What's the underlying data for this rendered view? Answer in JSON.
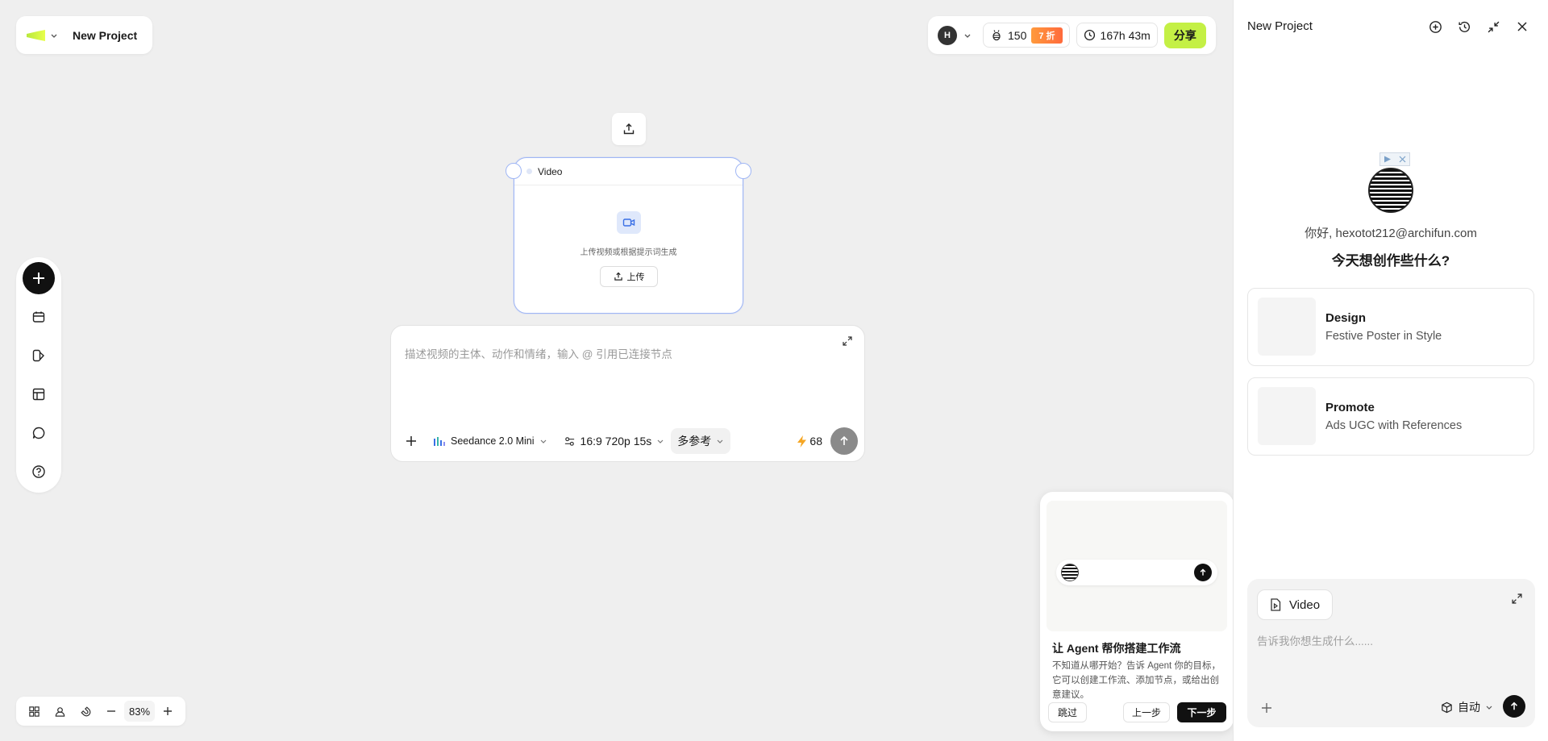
{
  "project": {
    "title": "New Project"
  },
  "status": {
    "avatar_letter": "H",
    "credits": "150",
    "discount": "7 折",
    "time_left": "167h 43m",
    "share_label": "分享"
  },
  "node": {
    "title": "Video",
    "hint": "上传视频或根据提示词生成",
    "upload_label": "上传"
  },
  "prompt": {
    "placeholder": "描述视频的主体、动作和情绪，输入 @ 引用已连接节点",
    "model": "Seedance 2.0 Mini",
    "settings": "16:9 720p 15s",
    "reference": "多参考",
    "cost": "68"
  },
  "zoom": {
    "level": "83%"
  },
  "tour": {
    "title": "让 Agent 帮你搭建工作流",
    "body": "不知道从哪开始？告诉 Agent 你的目标，它可以创建工作流、添加节点，或给出创意建议。",
    "skip": "跳过",
    "prev": "上一步",
    "next": "下一步"
  },
  "panel": {
    "title": "New Project",
    "greeting": "你好, hexotot212@archifun.com",
    "question": "今天想创作些什么?",
    "suggestions": [
      {
        "title": "Design",
        "subtitle": "Festive Poster in Style"
      },
      {
        "title": "Promote",
        "subtitle": "Ads UGC with References"
      }
    ],
    "composer": {
      "chip": "Video",
      "placeholder": "告诉我你想生成什么......",
      "mode": "自动"
    }
  },
  "colors": {
    "accent": "#c4f045",
    "node_border": "#9fb6f5",
    "background": "#efefef"
  }
}
